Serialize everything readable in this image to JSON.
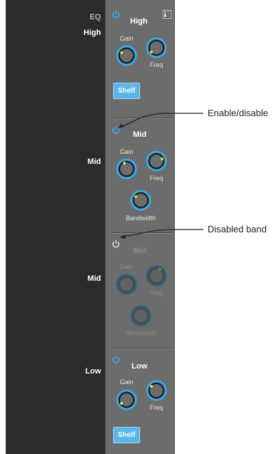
{
  "eq_label": "EQ",
  "row_labels": {
    "high": "High",
    "mid1": "Mid",
    "mid2": "Mid",
    "low": "Low"
  },
  "bands": {
    "high": {
      "title": "High",
      "gain_label": "Gain",
      "freq_label": "Freq",
      "shelf_label": "Shelf",
      "enabled": true
    },
    "mid1": {
      "title": "Mid",
      "gain_label": "Gain",
      "freq_label": "Freq",
      "bandwidth_label": "Bandwidth",
      "enabled": true
    },
    "mid2": {
      "title": "Mid",
      "gain_label": "Gain",
      "freq_label": "Freq",
      "bandwidth_label": "Bandwidth",
      "enabled": false
    },
    "low": {
      "title": "Low",
      "gain_label": "Gain",
      "freq_label": "Freq",
      "shelf_label": "Shelf",
      "enabled": true
    }
  },
  "callouts": {
    "enable": "Enable/disable",
    "disabled": "Disabled band"
  },
  "icons": {
    "power": "power-icon",
    "menu": "channel-menu-icon"
  },
  "colors": {
    "accent_blue": "#39a9e6",
    "knob_body": "#6d6d6d",
    "indicator_yellow": "#d8e33a",
    "shelf_button": "#5ab6e8"
  }
}
